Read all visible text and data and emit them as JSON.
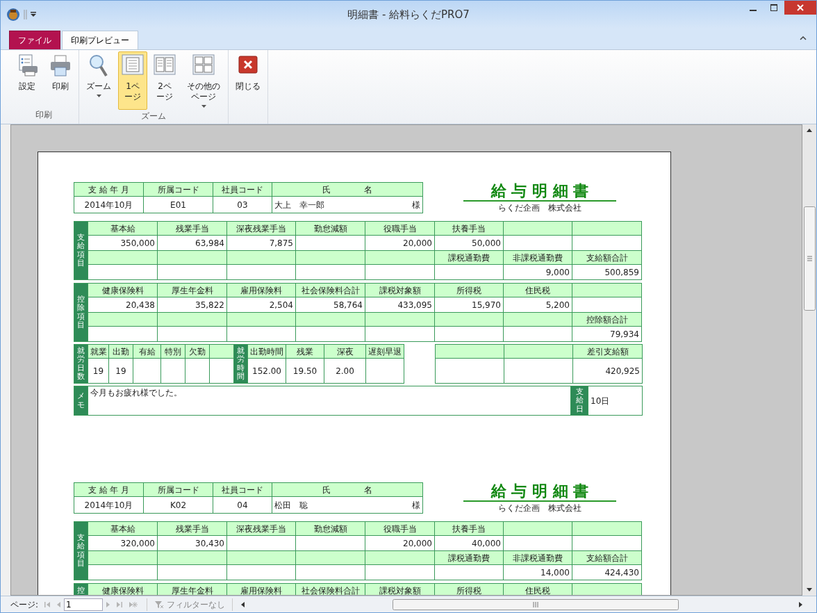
{
  "window": {
    "title": "明細書 - 給料らくだPRO7"
  },
  "tabs": [
    {
      "label": "ファイル",
      "kind": "file",
      "selected": false
    },
    {
      "label": "印刷プレビュー",
      "kind": "tab",
      "selected": true
    }
  ],
  "ribbon": {
    "groups": [
      {
        "label": "印刷",
        "buttons": [
          {
            "label": "設定",
            "kind": "setup",
            "selected": false,
            "dropdown": false
          },
          {
            "label": "印刷",
            "kind": "print",
            "selected": false,
            "dropdown": false
          }
        ]
      },
      {
        "label": "ズーム",
        "buttons": [
          {
            "label": "ズーム",
            "kind": "zoom",
            "selected": false,
            "dropdown": true
          },
          {
            "label": "1ページ",
            "kind": "one-page",
            "selected": true,
            "dropdown": false
          },
          {
            "label": "2ページ",
            "kind": "two-page",
            "selected": false,
            "dropdown": false
          },
          {
            "label": "その他のページ",
            "kind": "more-pages",
            "selected": false,
            "dropdown": true
          }
        ]
      },
      {
        "buttons": [
          {
            "label": "閉じる",
            "kind": "close",
            "selected": false,
            "dropdown": false
          }
        ]
      }
    ]
  },
  "slips": [
    {
      "header": {
        "labels": [
          "支 給 年 月",
          "所属コード",
          "社員コード",
          "氏　　　　名"
        ],
        "values": [
          "2014年10月",
          "E01",
          "03",
          "大上　幸一郎"
        ],
        "honorific": "様"
      },
      "title": "給 与 明 細 書",
      "company": "らくだ企画　株式会社",
      "payments": {
        "side_label": "支給項目",
        "columns": [
          {
            "top_label": "基本給",
            "top_value": "350,000"
          },
          {
            "top_label": "残業手当",
            "top_value": "63,984"
          },
          {
            "top_label": "深夜残業手当",
            "top_value": "7,875"
          },
          {
            "top_label": "勤怠減額"
          },
          {
            "top_label": "役職手当",
            "top_value": "20,000"
          },
          {
            "top_label": "扶養手当",
            "top_value": "50,000",
            "bottom_label": "課税通勤費"
          },
          {
            "bottom_label": "非課税通勤費",
            "bottom_value": "9,000"
          },
          {
            "bottom_label": "支給額合計",
            "bottom_value": "500,859"
          }
        ]
      },
      "deductions": {
        "side_label": "控除項目",
        "columns": [
          {
            "top_label": "健康保険料",
            "top_value": "20,438"
          },
          {
            "top_label": "厚生年金料",
            "top_value": "35,822"
          },
          {
            "top_label": "雇用保険料",
            "top_value": "2,504"
          },
          {
            "top_label": "社会保険料合計",
            "top_value": "58,764"
          },
          {
            "top_label": "課税対象額",
            "top_value": "433,095"
          },
          {
            "top_label": "所得税",
            "top_value": "15,970"
          },
          {
            "top_label": "住民税",
            "top_value": "5,200"
          },
          {
            "bottom_label": "控除額合計",
            "bottom_value": "79,934"
          }
        ]
      },
      "attendance": {
        "days_label": "就労日数",
        "days": [
          {
            "label": "就業",
            "value": "19"
          },
          {
            "label": "出勤",
            "value": "19"
          },
          {
            "label": "有給"
          },
          {
            "label": "特別"
          },
          {
            "label": "欠勤"
          },
          {
            "kind": "blank"
          }
        ],
        "hours_label": "就労時間",
        "hours": [
          {
            "label": "出勤時間",
            "value": "152.00"
          },
          {
            "label": "残業",
            "value": "19.50"
          },
          {
            "label": "深夜",
            "value": "2.00"
          },
          {
            "label": "遅刻早退"
          }
        ],
        "totals": [
          {
            "kind": "blank"
          },
          {
            "kind": "blank"
          },
          {
            "kind": "amount",
            "label": "差引支給額",
            "value": "420,925"
          }
        ]
      },
      "memo": {
        "side_label": "メモ",
        "text": "今月もお疲れ様でした。",
        "payday_label": "支給日",
        "payday": "10日"
      }
    },
    {
      "header": {
        "labels": [
          "支 給 年 月",
          "所属コード",
          "社員コード",
          "氏　　　　名"
        ],
        "values": [
          "2014年10月",
          "K02",
          "04",
          "松田　聡"
        ],
        "honorific": "様"
      },
      "title": "給 与 明 細 書",
      "company": "らくだ企画　株式会社",
      "payments": {
        "side_label": "支給項目",
        "columns": [
          {
            "top_label": "基本給",
            "top_value": "320,000"
          },
          {
            "top_label": "残業手当",
            "top_value": "30,430"
          },
          {
            "top_label": "深夜残業手当"
          },
          {
            "top_label": "勤怠減額"
          },
          {
            "top_label": "役職手当",
            "top_value": "20,000"
          },
          {
            "top_label": "扶養手当",
            "top_value": "40,000",
            "bottom_label": "課税通勤費"
          },
          {
            "bottom_label": "非課税通勤費",
            "bottom_value": "14,000"
          },
          {
            "bottom_label": "支給額合計",
            "bottom_value": "424,430"
          }
        ]
      },
      "deductions": {
        "side_label": "控",
        "columns": [
          {
            "top_label": "健康保険料"
          },
          {
            "top_label": "厚生年金料"
          },
          {
            "top_label": "雇用保険料"
          },
          {
            "top_label": "社会保険料合計"
          },
          {
            "top_label": "課税対象額"
          },
          {
            "top_label": "所得税"
          },
          {
            "top_label": "住民税"
          },
          {
            "kind": "blank"
          }
        ]
      }
    }
  ],
  "navigation": {
    "label": "ページ:",
    "before": [
      {
        "kind": "first",
        "disabled": true
      },
      {
        "kind": "previous",
        "disabled": true
      }
    ],
    "page": "1",
    "after": [
      {
        "kind": "next",
        "disabled": true
      },
      {
        "kind": "last",
        "disabled": true
      },
      {
        "kind": "new",
        "disabled": true
      }
    ],
    "filter": "フィルターなし"
  }
}
